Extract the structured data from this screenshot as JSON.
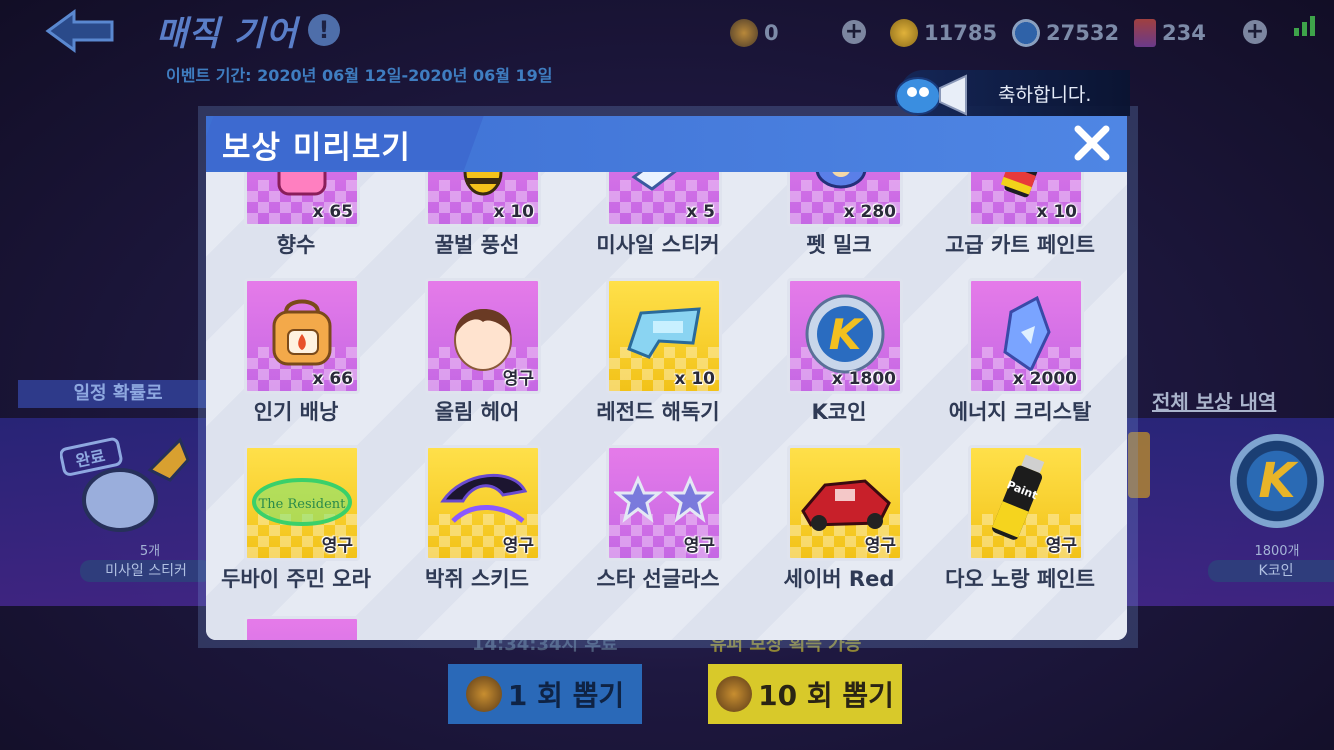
{
  "header": {
    "title": "매직 기어",
    "info_icon": "!",
    "event_period": "이벤트 기간: 2020년 06월 12일-2020년 06월 19일"
  },
  "currencies": [
    {
      "name": "gear-token",
      "value": "0"
    },
    {
      "name": "gold-coin",
      "value": "11785"
    },
    {
      "name": "k-coin",
      "value": "27532"
    },
    {
      "name": "energy",
      "value": "234"
    }
  ],
  "notification": {
    "text": "축하합니다. "
  },
  "background": {
    "prob_label": "일정 확률로",
    "left_item": {
      "count": "5개",
      "name": "미사일 스티커"
    },
    "right_item": {
      "count": "1800개",
      "name": "K코인",
      "coin_letter": "K"
    },
    "all_rewards_link": "전체 보상 내역",
    "timer": "14:34:34시 후료",
    "guarantee": "유퍼 보상 획득 가능",
    "draw_1": "1 회 뽑기",
    "draw_10": "10 회 뽑기",
    "complete_stamp": "완료"
  },
  "modal": {
    "title": "보상 미리보기",
    "close": "✕",
    "rows": [
      [
        {
          "name": "향수",
          "qty": "x 65",
          "bg": "purple",
          "icon": "perfume-icon"
        },
        {
          "name": "꿀벌 풍선",
          "qty": "x 10",
          "bg": "purple",
          "icon": "bee-balloon-icon"
        },
        {
          "name": "미사일 스티커",
          "qty": "x 5",
          "bg": "purple",
          "icon": "missile-sticker-icon"
        },
        {
          "name": "펫 밀크",
          "qty": "x 280",
          "bg": "purple",
          "icon": "pet-milk-icon"
        },
        {
          "name": "고급 카트 페인트",
          "qty": "x 10",
          "bg": "purple",
          "icon": "paint-can-icon"
        }
      ],
      [
        {
          "name": "인기 배낭",
          "qty": "x 66",
          "bg": "purple",
          "icon": "backpack-icon"
        },
        {
          "name": "올림 헤어",
          "qty": "영구",
          "bg": "purple",
          "icon": "hair-icon"
        },
        {
          "name": "레전드 해독기",
          "qty": "x 10",
          "bg": "gold",
          "icon": "decoder-icon"
        },
        {
          "name": "K코인",
          "qty": "x 1800",
          "bg": "purple",
          "icon": "k-coin-icon",
          "coin_letter": "K"
        },
        {
          "name": "에너지 크리스탈",
          "qty": "x 2000",
          "bg": "purple",
          "icon": "energy-crystal-icon"
        }
      ],
      [
        {
          "name": "두바이 주민 오라",
          "qty": "영구",
          "bg": "gold",
          "icon": "aura-ring-icon",
          "aura_text": "The Resident"
        },
        {
          "name": "박쥐 스키드",
          "qty": "영구",
          "bg": "gold",
          "icon": "bat-skid-icon"
        },
        {
          "name": "스타 선글라스",
          "qty": "영구",
          "bg": "purple",
          "icon": "star-sunglasses-icon"
        },
        {
          "name": "세이버 Red",
          "qty": "영구",
          "bg": "gold",
          "icon": "kart-icon"
        },
        {
          "name": "다오 노랑 페인트",
          "qty": "영구",
          "bg": "gold",
          "icon": "yellow-paint-icon",
          "paint_label": "Paint"
        }
      ]
    ],
    "paint_label": "Paint"
  },
  "colors": {
    "modal_header": "#4a7fe0",
    "card_purple": "#d874e8",
    "card_gold": "#f6cf2c",
    "page_bg": "#1e1840"
  }
}
